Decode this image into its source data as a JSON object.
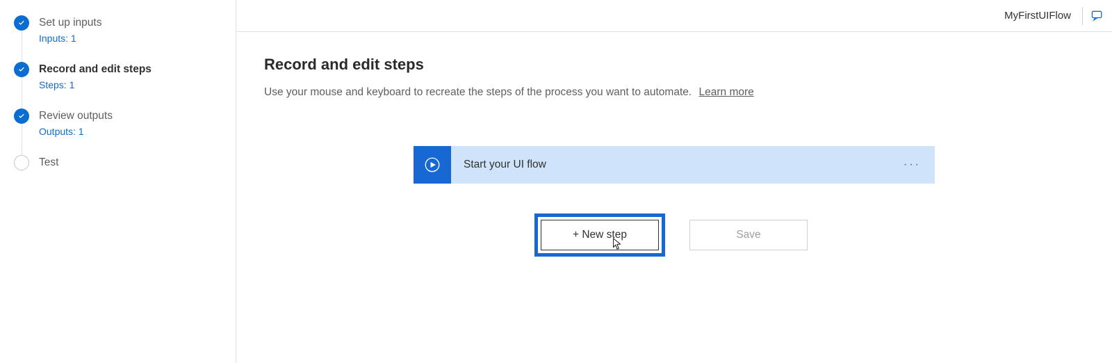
{
  "header": {
    "flow_name": "MyFirstUIFlow"
  },
  "sidebar": {
    "steps": [
      {
        "title": "Set up inputs",
        "sub": "Inputs: 1",
        "status": "done"
      },
      {
        "title": "Record and edit steps",
        "sub": "Steps: 1",
        "status": "done",
        "active": true
      },
      {
        "title": "Review outputs",
        "sub": "Outputs: 1",
        "status": "done"
      },
      {
        "title": "Test",
        "sub": "",
        "status": "pending"
      }
    ]
  },
  "main": {
    "title": "Record and edit steps",
    "description": "Use your mouse and keyboard to recreate the steps of the process you want to automate.",
    "learn_more_label": "Learn more"
  },
  "flow": {
    "card_label": "Start your UI flow",
    "more_glyph": "···"
  },
  "buttons": {
    "new_step": "+ New step",
    "save": "Save"
  }
}
